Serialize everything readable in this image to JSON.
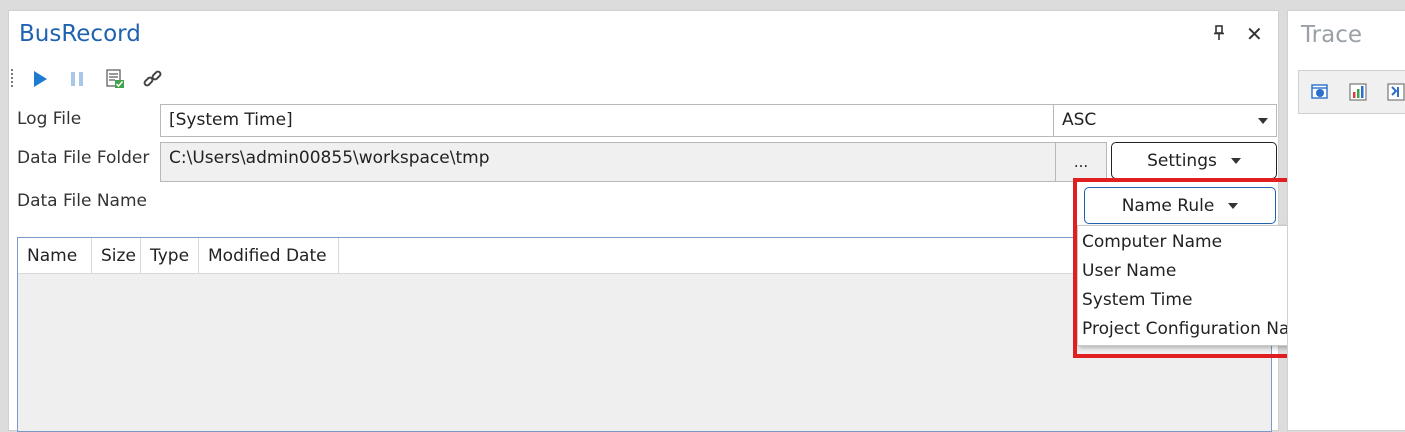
{
  "busrecord": {
    "title": "BusRecord",
    "pin_glyph": "♀",
    "close_glyph": "✕"
  },
  "toolbar": {
    "icons": [
      "play-icon",
      "pause-icon",
      "log-list-icon",
      "link-icon"
    ],
    "colors": {
      "play": "#1f7bd1",
      "pause": "#a9c7e8"
    }
  },
  "form": {
    "log_file_label": "Log File",
    "log_file_value": "[System Time]",
    "format_value": "ASC",
    "data_file_folder_label": "Data File Folder",
    "data_file_folder_value": "C:\\Users\\admin00855\\workspace\\tmp",
    "browse_label": "...",
    "settings_label": "Settings",
    "data_file_name_label": "Data File Name",
    "name_rule_label": "Name Rule"
  },
  "table": {
    "columns": [
      "Name",
      "Size",
      "Type",
      "Modified Date"
    ]
  },
  "name_rule_menu": {
    "items": [
      "Computer Name",
      "User Name",
      "System Time",
      "Project Configuration Name"
    ]
  },
  "trace": {
    "title": "Trace",
    "icons": [
      "trace-view-icon",
      "bar-chart-icon",
      "import-icon"
    ]
  },
  "colors": {
    "accent": "#1f63b0",
    "highlight": "#e02020"
  }
}
